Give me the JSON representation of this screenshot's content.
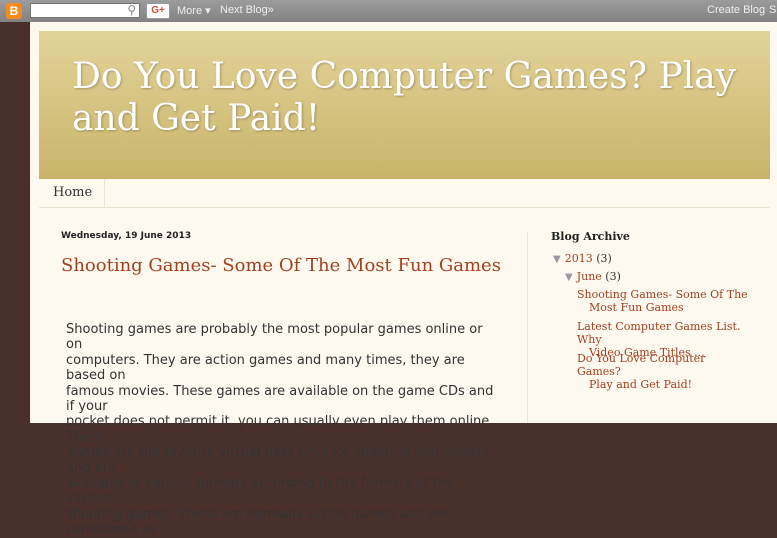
{
  "navbar": {
    "logo_letter": "B",
    "search_icon": "⚲",
    "gplus_label": "G+",
    "more_label": "More ▾",
    "next_label": "Next Blog»",
    "create_label": "Create Blog",
    "signin_label": "S"
  },
  "blog": {
    "title": "Do You Love Computer Games? Play and Get Paid!",
    "tabs": [
      {
        "label": "Home"
      }
    ]
  },
  "post": {
    "date": "Wednesday, 19 June 2013",
    "title": "Shooting Games- Some Of The Most Fun Games",
    "body_lines": [
      "Shooting games are probably the most popular games online or on",
      "computers. They are action games and many times, they are based on",
      "famous movies. These games are available on the game CDs and if your",
      "pocket does not permit it, you can usually even play them online. These",
      "games are the favorite virtual pass time for shooting enthusiasts and are",
      "available in various formats according to the formats of the various",
      "shooting games. These are normally action games and are considered as"
    ]
  },
  "sidebar": {
    "archive_heading": "Blog Archive",
    "year": {
      "label": "2013",
      "count": "(3)",
      "toggle": "▼"
    },
    "month": {
      "label": "June",
      "count": "(3)",
      "toggle": "▼"
    },
    "posts": [
      {
        "line1": "Shooting Games- Some Of The",
        "line2": "Most Fun Games"
      },
      {
        "line1": "Latest Computer Games List. Why",
        "line2": "Video Game Titles ..."
      },
      {
        "line1": "Do You Love Computer Games?",
        "line2": "Play and Get Paid!"
      }
    ]
  }
}
